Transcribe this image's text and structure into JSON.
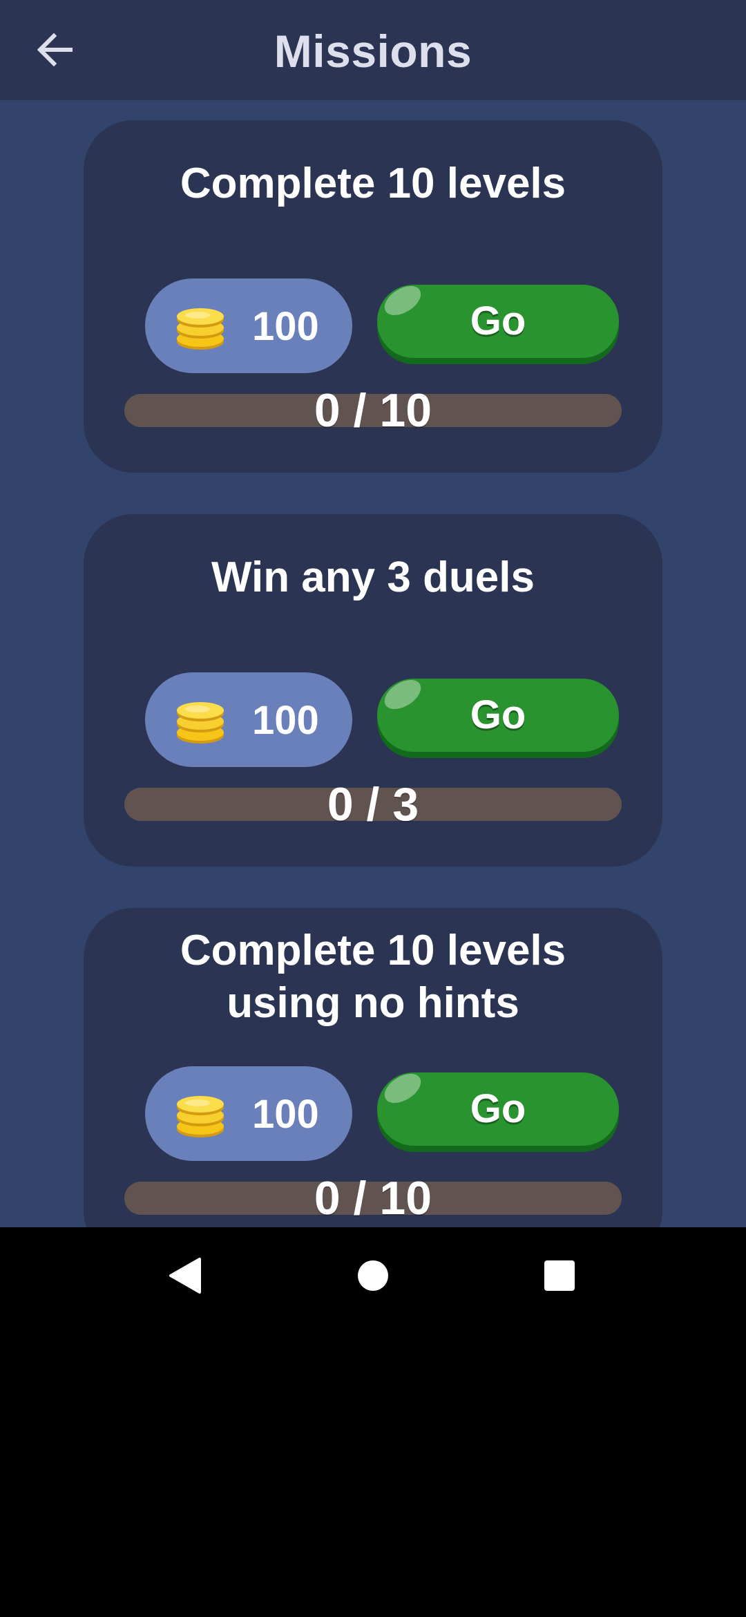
{
  "header": {
    "title": "Missions",
    "back_icon": "arrow-left-icon"
  },
  "missions": [
    {
      "title_lines": [
        "Complete 10 levels"
      ],
      "reward": "100",
      "go_label": "Go",
      "progress_text": "0 / 10",
      "progress_fraction": 0
    },
    {
      "title_lines": [
        "Win any 3 duels"
      ],
      "reward": "100",
      "go_label": "Go",
      "progress_text": "0 / 3",
      "progress_fraction": 0
    },
    {
      "title_lines": [
        "Complete 10 levels",
        "using no hints"
      ],
      "reward": "100",
      "go_label": "Go",
      "progress_text": "0 / 10",
      "progress_fraction": 0
    }
  ],
  "navbar": {
    "back_icon": "triangle-back-icon",
    "home_icon": "circle-home-icon",
    "recents_icon": "square-recents-icon"
  },
  "colors": {
    "background": "#32446b",
    "card": "#2b3553",
    "reward_pill": "#6a80bb",
    "go_button": "#28932f",
    "progress_track": "#61534f"
  }
}
